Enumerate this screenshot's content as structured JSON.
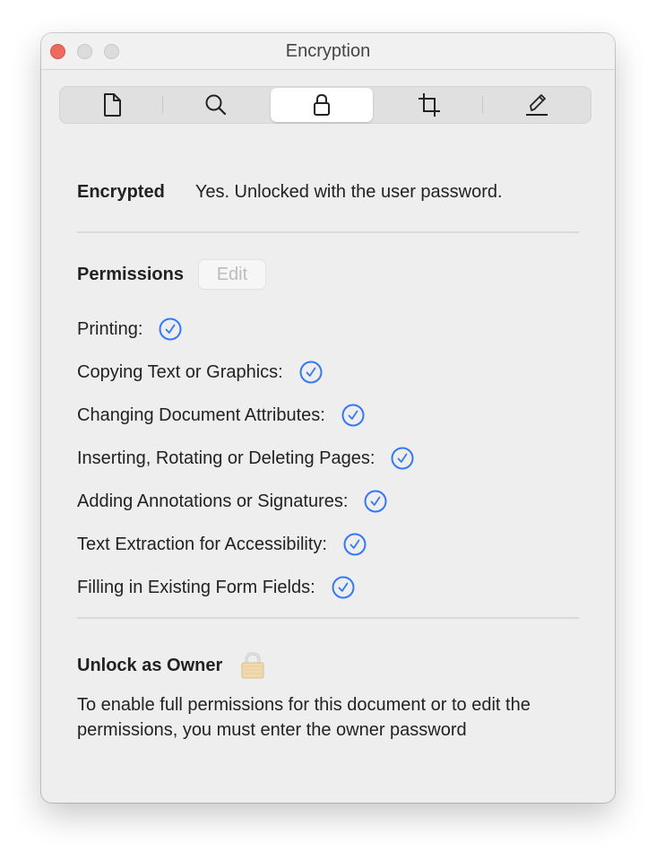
{
  "window": {
    "title": "Encryption",
    "traffic_lights": [
      "close",
      "minimize",
      "zoom"
    ]
  },
  "toolbar": {
    "tabs": [
      {
        "icon": "document-icon",
        "label": "General Info",
        "active": false
      },
      {
        "icon": "search-icon",
        "label": "Keywords",
        "active": false
      },
      {
        "icon": "lock-icon",
        "label": "Encryption",
        "active": true
      },
      {
        "icon": "crop-icon",
        "label": "Crop",
        "active": false
      },
      {
        "icon": "pencil-icon",
        "label": "Annotations",
        "active": false
      }
    ]
  },
  "encryption": {
    "label": "Encrypted",
    "value": "Yes. Unlocked with the user password."
  },
  "permissions": {
    "label": "Permissions",
    "edit_label": "Edit",
    "edit_enabled": false,
    "items": [
      {
        "label": "Printing:",
        "allowed": true
      },
      {
        "label": "Copying Text or Graphics:",
        "allowed": true
      },
      {
        "label": "Changing Document Attributes:",
        "allowed": true
      },
      {
        "label": "Inserting, Rotating or Deleting Pages:",
        "allowed": true
      },
      {
        "label": "Adding Annotations or Signatures:",
        "allowed": true
      },
      {
        "label": "Text Extraction for Accessibility:",
        "allowed": true
      },
      {
        "label": "Filling in Existing Form Fields:",
        "allowed": true
      }
    ]
  },
  "owner": {
    "label": "Unlock as Owner",
    "icon": "padlock-icon",
    "description": "To enable full permissions for this document or to edit the permissions, you must enter the owner password"
  },
  "colors": {
    "accent": "#3478f6",
    "close": "#ee6a5f"
  }
}
